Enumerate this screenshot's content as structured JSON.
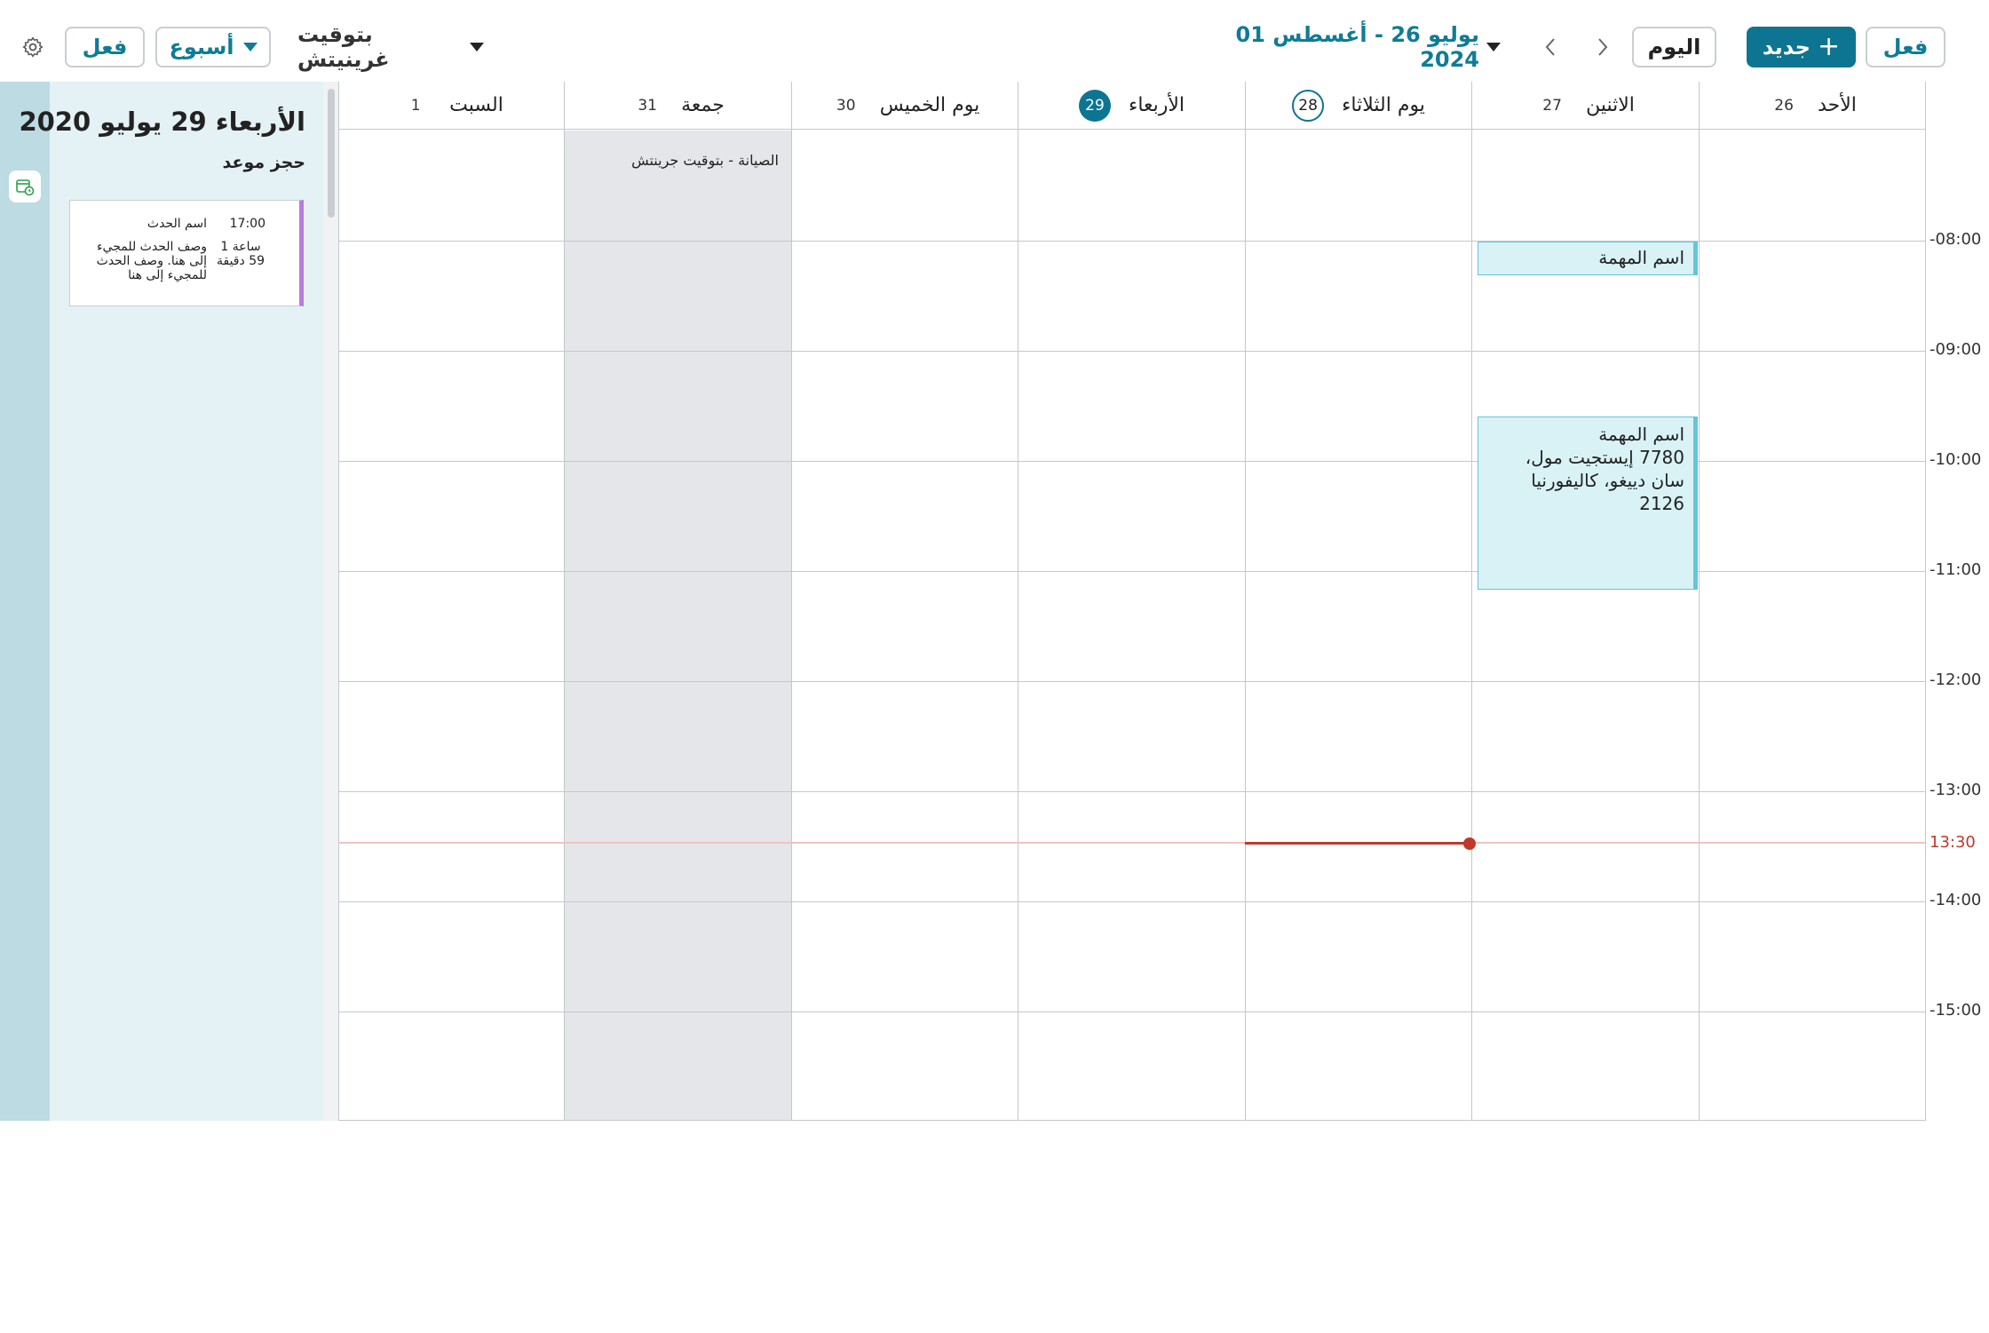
{
  "toolbar": {
    "do_right_label": "فعل",
    "new_label": "جديد",
    "today_label": "اليوم",
    "date_range": "يوليو 26 - أغسطس 01 2024",
    "timezone": "بتوقيت غرينيتش",
    "view_label": "أسبوع",
    "do_left_label": "فعل"
  },
  "side_panel": {
    "date": "الأربعاء 29 يوليو 2020",
    "subtitle": "حجز موعد",
    "card": {
      "time": "17:00",
      "name": "اسم الحدث",
      "duration": "1 ساعة 59 دقيقة",
      "description": "وصف الحدث للمجيء إلى هنا. وصف الحدث للمجيء إلى هنا",
      "accent_color": "#b97be0"
    }
  },
  "days": [
    {
      "name": "الأحد",
      "num": "26"
    },
    {
      "name": "الاثنين",
      "num": "27"
    },
    {
      "name": "يوم الثلاثاء",
      "num": "28"
    },
    {
      "name": "الأربعاء",
      "num": "29"
    },
    {
      "name": "يوم الخميس",
      "num": "30"
    },
    {
      "name": "جمعة",
      "num": "31"
    },
    {
      "name": "السبت",
      "num": "1"
    }
  ],
  "hours": [
    "-08:00",
    "-09:00",
    "-10:00",
    "-11:00",
    "-12:00",
    "-13:00",
    "-14:00",
    "-15:00"
  ],
  "now_label": "13:30",
  "events": {
    "maintenance": "الصيانة - بتوقيت جرينتش",
    "task1_title": "اسم المهمة",
    "task2_title": "اسم المهمة",
    "task2_address": "7780 إيستجيت مول، سان دييغو، كاليفورنيا 2126"
  },
  "colors": {
    "accent": "#0d7591",
    "event_fill": "#d8f2f6",
    "event_border": "#63c6d9",
    "now_line": "#c0392b",
    "maintenance_fill": "#e4e6ea"
  }
}
